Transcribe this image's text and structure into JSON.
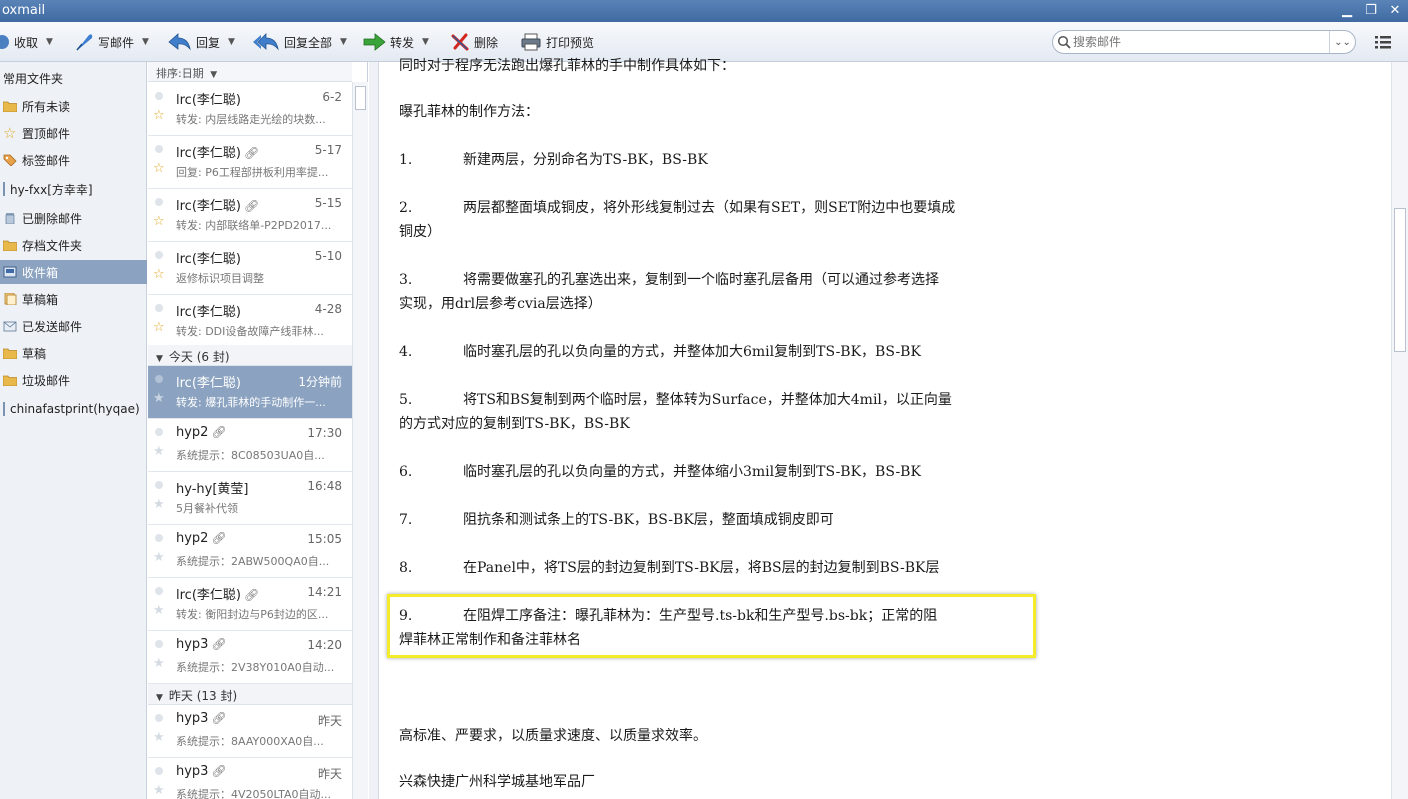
{
  "window": {
    "title": "oxmail"
  },
  "toolbar": {
    "receive": "收取",
    "compose": "写邮件",
    "reply": "回复",
    "reply_all": "回复全部",
    "forward": "转发",
    "delete": "删除",
    "print_preview": "打印预览"
  },
  "search": {
    "placeholder": "搜索邮件"
  },
  "sidebar": {
    "items": [
      {
        "label": "常用文件夹"
      },
      {
        "label": "所有未读"
      },
      {
        "label": "置顶邮件"
      },
      {
        "label": "标签邮件"
      },
      {
        "label": "hy-fxx[方幸幸]"
      },
      {
        "label": "已删除邮件"
      },
      {
        "label": "存档文件夹"
      },
      {
        "label": "收件箱"
      },
      {
        "label": "草稿箱"
      },
      {
        "label": "已发送邮件"
      },
      {
        "label": "草稿"
      },
      {
        "label": "垃圾邮件"
      },
      {
        "label": "chinafastprint(hyqae)"
      }
    ]
  },
  "list": {
    "sort_label": "排序:日期",
    "groups": [
      {
        "label": "今天 (6 封)"
      },
      {
        "label": "昨天 (13 封)"
      }
    ],
    "messages": [
      {
        "sender": "lrc(李仁聪)",
        "time": "6-2",
        "subject": "转发: 内层线路走光绘的块数..."
      },
      {
        "sender": "lrc(李仁聪)",
        "time": "5-17",
        "subject": "回复: P6工程部拼板利用率提..."
      },
      {
        "sender": "lrc(李仁聪)",
        "time": "5-15",
        "subject": "转发: 内部联络单-P2PD2017..."
      },
      {
        "sender": "lrc(李仁聪)",
        "time": "5-10",
        "subject": "返修标识项目调整"
      },
      {
        "sender": "lrc(李仁聪)",
        "time": "4-28",
        "subject": "转发: DDI设备故障产线菲林..."
      },
      {
        "sender": "lrc(李仁聪)",
        "time": "1分钟前",
        "subject": "转发: 爆孔菲林的手动制作一..."
      },
      {
        "sender": "hyp2",
        "time": "17:30",
        "subject": "系统提示：8C08503UA0自..."
      },
      {
        "sender": "hy-hy[黄莹]",
        "time": "16:48",
        "subject": "5月餐补代领"
      },
      {
        "sender": "hyp2",
        "time": "15:05",
        "subject": "系统提示：2ABW500QA0自..."
      },
      {
        "sender": "lrc(李仁聪)",
        "time": "14:21",
        "subject": "转发: 衡阳封边与P6封边的区..."
      },
      {
        "sender": "hyp3",
        "time": "14:20",
        "subject": "系统提示：2V38Y010A0自动..."
      },
      {
        "sender": "hyp3",
        "time": "昨天",
        "subject": "系统提示：8AAY000XA0自..."
      },
      {
        "sender": "hyp3",
        "time": "昨天",
        "subject": "系统提示：4V2050LTA0自动..."
      }
    ]
  },
  "email": {
    "intro": "同时对于程序无法跑出爆孔菲林的手中制作具体如下：",
    "heading": "曝孔菲林的制作方法：",
    "steps": [
      {
        "num": "1.",
        "text": "新建两层，分别命名为TS-BK，BS-BK"
      },
      {
        "num": "2.",
        "text": "两层都整面填成铜皮，将外形线复制过去（如果有SET，则SET附边中也要填成",
        "cont": "铜皮）"
      },
      {
        "num": "3.",
        "text": "将需要做塞孔的孔塞选出来，复制到一个临时塞孔层备用（可以通过参考选择",
        "cont": "实现，用drl层参考cvia层选择）"
      },
      {
        "num": "4.",
        "text": "临时塞孔层的孔以负向量的方式，并整体加大6mil复制到TS-BK，BS-BK"
      },
      {
        "num": "5.",
        "text": "将TS和BS复制到两个临时层，整体转为Surface，并整体加大4mil，以正向量",
        "cont": "的方式对应的复制到TS-BK，BS-BK"
      },
      {
        "num": "6.",
        "text": "临时塞孔层的孔以负向量的方式，并整体缩小3mil复制到TS-BK，BS-BK"
      },
      {
        "num": "7.",
        "text": "阻抗条和测试条上的TS-BK，BS-BK层，整面填成铜皮即可"
      },
      {
        "num": "8.",
        "text": "在Panel中，将TS层的封边复制到TS-BK层，将BS层的封边复制到BS-BK层"
      },
      {
        "num": "9.",
        "text": "在阻焊工序备注：曝孔菲林为：生产型号.ts-bk和生产型号.bs-bk；正常的阻",
        "cont": "焊菲林正常制作和备注菲林名"
      }
    ],
    "slogan": "高标准、严要求，以质量求速度、以质量求效率。",
    "signature": "兴森快捷广州科学城基地军品厂"
  }
}
